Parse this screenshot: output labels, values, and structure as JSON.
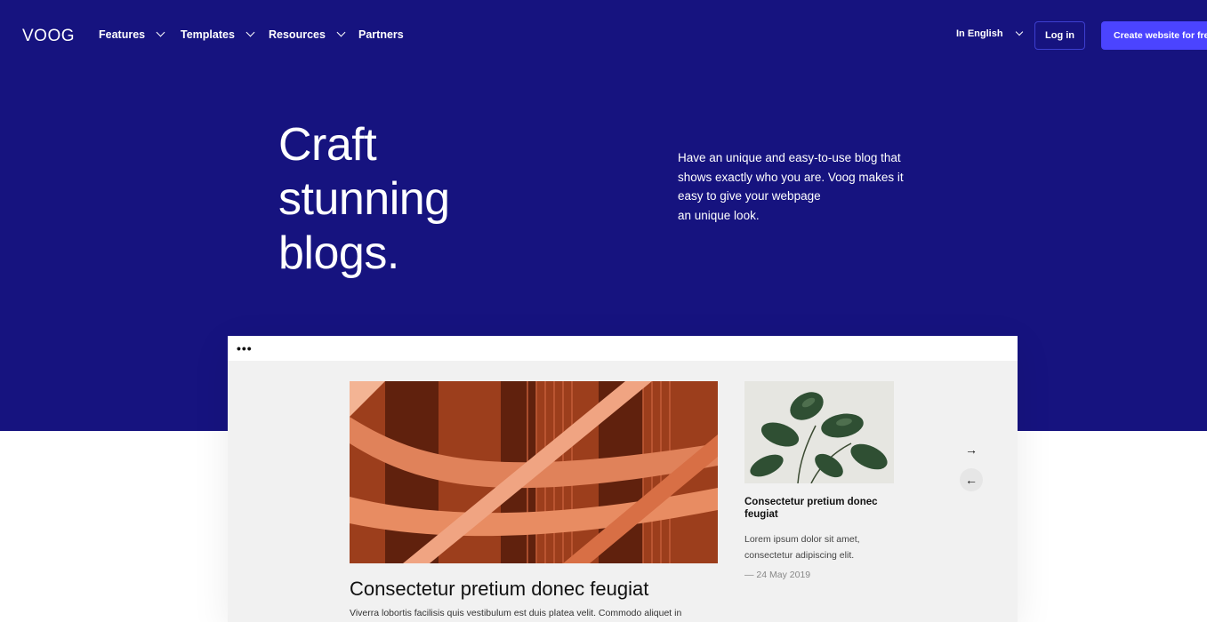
{
  "header": {
    "logo": "VOOG",
    "nav": [
      {
        "label": "Features",
        "has_dropdown": true
      },
      {
        "label": "Templates",
        "has_dropdown": true
      },
      {
        "label": "Resources",
        "has_dropdown": true
      },
      {
        "label": "Partners",
        "has_dropdown": false
      }
    ],
    "language": "In English",
    "login_label": "Log in",
    "create_label": "Create website for free"
  },
  "hero": {
    "title_lines": [
      "Craft",
      "stunning",
      "blogs."
    ],
    "description_lines": [
      "Have an unique and easy-to-use blog that",
      "shows exactly who you are. Voog makes it",
      "easy to give your webpage",
      "an unique look."
    ]
  },
  "mockup": {
    "menu_dots": "•••",
    "main_post": {
      "title": "Consectetur pretium donec feugiat",
      "excerpt": "Viverra lobortis facilisis quis vestibulum est duis platea velit. Commodo aliquet in"
    },
    "side_post": {
      "title": "Consectetur pretium donec feugiat",
      "excerpt": "Lorem ipsum dolor sit amet, consectetur adipiscing elit.",
      "date": "— 24 May 2019"
    },
    "next_arrow": "→",
    "prev_arrow": "←"
  },
  "colors": {
    "hero_background": "#16137f",
    "accent": "#4b44ff",
    "mockup_background": "#f1f1f1"
  }
}
